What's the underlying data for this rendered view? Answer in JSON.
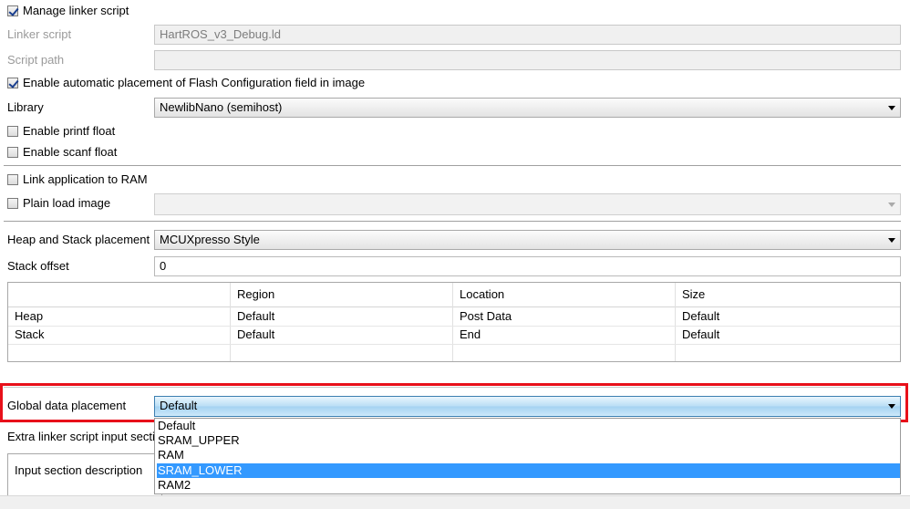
{
  "manage_linker_script": {
    "label": "Manage linker script",
    "checked": true
  },
  "linker_script": {
    "label": "Linker script",
    "value": "HartROS_v3_Debug.ld"
  },
  "script_path": {
    "label": "Script path",
    "value": ""
  },
  "flash_config": {
    "label": "Enable automatic placement of Flash Configuration field in image",
    "checked": true
  },
  "library": {
    "label": "Library",
    "value": "NewlibNano (semihost)"
  },
  "printf_float": {
    "label": "Enable printf float",
    "checked": false
  },
  "scanf_float": {
    "label": "Enable scanf float",
    "checked": false
  },
  "link_to_ram": {
    "label": "Link application to RAM",
    "checked": false
  },
  "plain_load_image": {
    "label": "Plain load image",
    "checked": false,
    "value": ""
  },
  "heap_stack_placement": {
    "label": "Heap and Stack placement",
    "value": "MCUXpresso Style"
  },
  "stack_offset": {
    "label": "Stack offset",
    "value": "0"
  },
  "heap_stack_table": {
    "headers": [
      "",
      "Region",
      "Location",
      "Size"
    ],
    "rows": [
      [
        "Heap",
        "Default",
        "Post Data",
        "Default"
      ],
      [
        "Stack",
        "Default",
        "End",
        "Default"
      ]
    ]
  },
  "global_data_placement": {
    "label": "Global data placement",
    "value": "Default",
    "options": [
      "Default",
      "SRAM_UPPER",
      "RAM",
      "SRAM_LOWER",
      "RAM2"
    ],
    "highlighted": "SRAM_LOWER"
  },
  "extra_linker": {
    "label": "Extra linker script input secti"
  },
  "input_section": {
    "header": "Input section description"
  },
  "colors": {
    "highlight": "#3399ff",
    "annotation": "#e8101a",
    "combo_active": "#a4d2f1"
  },
  "icons": [
    "checkbox-icon",
    "dropdown-arrow-icon"
  ]
}
